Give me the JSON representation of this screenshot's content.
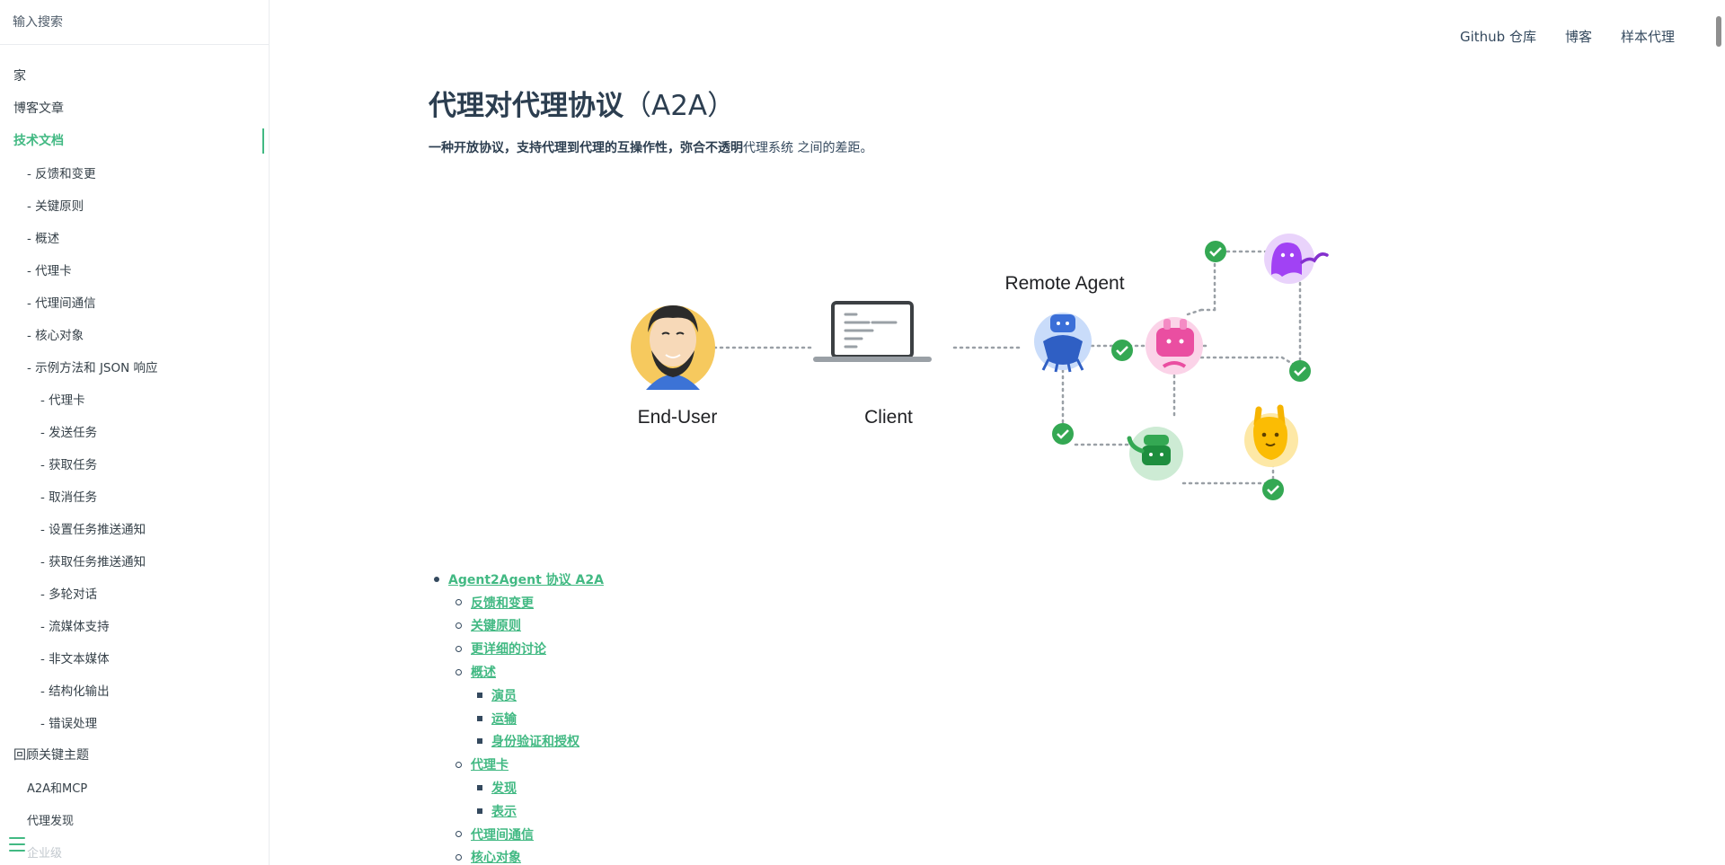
{
  "sidebar": {
    "search_placeholder": "输入搜索",
    "items": [
      {
        "label": "家",
        "level": 0
      },
      {
        "label": "博客文章",
        "level": 0
      },
      {
        "label": "技术文档",
        "level": 0,
        "active": true
      },
      {
        "label": "- 反馈和变更",
        "level": 1
      },
      {
        "label": "- 关键原则",
        "level": 1
      },
      {
        "label": "- 概述",
        "level": 1
      },
      {
        "label": "- 代理卡",
        "level": 1
      },
      {
        "label": "- 代理间通信",
        "level": 1
      },
      {
        "label": "- 核心对象",
        "level": 1
      },
      {
        "label": "- 示例方法和 JSON 响应",
        "level": 1
      },
      {
        "label": "- 代理卡",
        "level": 2
      },
      {
        "label": "- 发送任务",
        "level": 2
      },
      {
        "label": "- 获取任务",
        "level": 2
      },
      {
        "label": "- 取消任务",
        "level": 2
      },
      {
        "label": "- 设置任务推送通知",
        "level": 2
      },
      {
        "label": "- 获取任务推送通知",
        "level": 2
      },
      {
        "label": "- 多轮对话",
        "level": 2
      },
      {
        "label": "- 流媒体支持",
        "level": 2
      },
      {
        "label": "- 非文本媒体",
        "level": 2
      },
      {
        "label": "- 结构化输出",
        "level": 2
      },
      {
        "label": "- 错误处理",
        "level": 2
      },
      {
        "label": "回顾关键主题",
        "level": 0
      },
      {
        "label": "A2A和MCP",
        "level": 1
      },
      {
        "label": "代理发现",
        "level": 1
      },
      {
        "label": "企业级",
        "level": 1,
        "faded": true
      }
    ]
  },
  "topnav": {
    "github": "Github 仓库",
    "blog": "博客",
    "samples": "样本代理"
  },
  "main": {
    "title": "代理对代理协议",
    "title_paren": "（A2A）",
    "subtitle_bold": "一种开放协议，支持代理到代理的互操作性，弥合不透明",
    "subtitle_rest": "代理系统 之间的差距。"
  },
  "hero": {
    "end_user_label": "End-User",
    "client_label": "Client",
    "remote_agent_label": "Remote Agent"
  },
  "toc": [
    {
      "label": "Agent2Agent 协议 A2A",
      "level": 0
    },
    {
      "label": "反馈和变更",
      "level": 1
    },
    {
      "label": "关键原则",
      "level": 1
    },
    {
      "label": "更详细的讨论",
      "level": 1
    },
    {
      "label": "概述",
      "level": 1
    },
    {
      "label": "演员",
      "level": 2
    },
    {
      "label": "运输",
      "level": 2
    },
    {
      "label": "身份验证和授权",
      "level": 2
    },
    {
      "label": "代理卡",
      "level": 1
    },
    {
      "label": "发现",
      "level": 2
    },
    {
      "label": "表示",
      "level": 2
    },
    {
      "label": "代理间通信",
      "level": 1
    },
    {
      "label": "核心对象",
      "level": 1
    }
  ],
  "colors": {
    "accent": "#42b983",
    "text": "#34495e",
    "check_green": "#34a853"
  }
}
